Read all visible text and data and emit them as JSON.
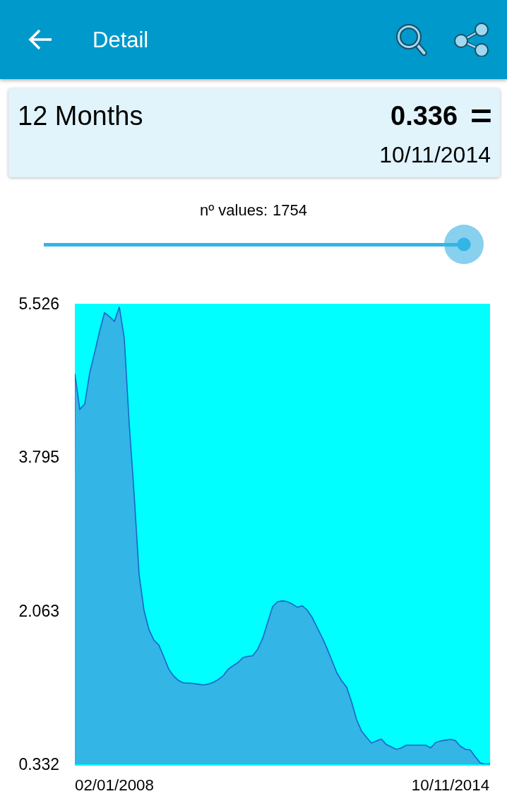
{
  "app_bar": {
    "title": "Detail"
  },
  "summary": {
    "period": "12 Months",
    "value": "0.336",
    "trend": "=",
    "date": "10/11/2014"
  },
  "slider": {
    "label": "nº values:",
    "reading": "1754",
    "level": 1
  },
  "chart": {
    "chart_data": {
      "type": "area",
      "categories": [
        null,
        null,
        null,
        null,
        null,
        null,
        null,
        null,
        "02/01/2008",
        null,
        null,
        null,
        null,
        null,
        null,
        null,
        null,
        null,
        null,
        null,
        null,
        null,
        null,
        null,
        null,
        null,
        null,
        null,
        null,
        null,
        null,
        null,
        null,
        null,
        null,
        null,
        null,
        null,
        null,
        null,
        null,
        null,
        null,
        null,
        null,
        null,
        null,
        null,
        null,
        null,
        null,
        null,
        null,
        null,
        null,
        null,
        null,
        null,
        null,
        null,
        null,
        null,
        null,
        null,
        null,
        null,
        null,
        null,
        null,
        null,
        null,
        null,
        null,
        null,
        null,
        null,
        "10/11/2014",
        null,
        null,
        null,
        null,
        null,
        null,
        null,
        null
      ],
      "series": [
        {
          "values": [
            4.737,
            4.336,
            4.395,
            4.745,
            4.974,
            5.213,
            5.425,
            5.383,
            5.327,
            5.489,
            5.136,
            4.172,
            3.375,
            2.472,
            2.066,
            1.85,
            1.732,
            1.677,
            1.543,
            1.404,
            1.326,
            1.276,
            1.248,
            1.248,
            1.243,
            1.235,
            1.226,
            1.237,
            1.256,
            1.286,
            1.33,
            1.402,
            1.443,
            1.479,
            1.535,
            1.549,
            1.557,
            1.631,
            1.752,
            1.93,
            2.109,
            2.164,
            2.175,
            2.167,
            2.139,
            2.103,
            2.119,
            2.073,
            1.989,
            1.877,
            1.766,
            1.642,
            1.503,
            1.364,
            1.272,
            1.2,
            1.033,
            0.836,
            0.706,
            0.637,
            0.572,
            0.595,
            0.616,
            0.555,
            0.529,
            0.502,
            0.516,
            0.547,
            0.547,
            0.547,
            0.547,
            0.547,
            0.517,
            0.578,
            0.595,
            0.604,
            0.613,
            0.6,
            0.535,
            0.502,
            0.493,
            0.417,
            0.348,
            0.334,
            0.336
          ]
        }
      ],
      "ylim": [
        0.332,
        5.526
      ],
      "yticks": [
        {
          "value": 5.526,
          "label": "5.526"
        },
        {
          "value": 3.795,
          "label": "3.795"
        },
        {
          "value": 2.063,
          "label": "2.063"
        },
        {
          "value": 0.332,
          "label": "0.332"
        }
      ]
    }
  }
}
